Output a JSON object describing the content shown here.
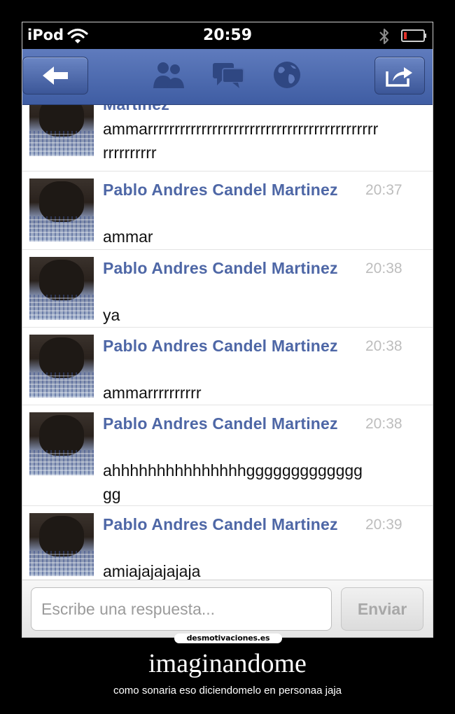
{
  "status_bar": {
    "carrier": "iPod",
    "time": "20:59",
    "wifi_icon": "wifi-icon",
    "bluetooth_icon": "bluetooth-icon",
    "battery_icon": "battery-low-icon",
    "battery_color": "#e0332b"
  },
  "nav_bar": {
    "back_icon": "back-arrow-icon",
    "tab_icons": [
      "friends-icon",
      "messages-icon",
      "globe-icon"
    ],
    "share_icon": "share-icon",
    "color": "#4b67ab"
  },
  "messages": [
    {
      "sender": "Martinez",
      "time": "",
      "text": "ammarrrrrrrrrrrrrrrrrrrrrrrrrrrrrrrrrrrrrrrrrrrrrrrrrrrrr"
    },
    {
      "sender": "Pablo Andres Candel Martinez",
      "time": "20:37",
      "text": "ammar"
    },
    {
      "sender": "Pablo Andres Candel Martinez",
      "time": "20:38",
      "text": "ya"
    },
    {
      "sender": "Pablo Andres Candel Martinez",
      "time": "20:38",
      "text": "ammarrrrrrrrrr"
    },
    {
      "sender": "Pablo Andres Candel Martinez",
      "time": "20:38",
      "text": "ahhhhhhhhhhhhhhhggggggggggggggg"
    },
    {
      "sender": "Pablo Andres Candel Martinez",
      "time": "20:39",
      "text": "amiajajajajaja"
    }
  ],
  "composer": {
    "placeholder": "Escribe una respuesta...",
    "send_label": "Enviar"
  },
  "poster": {
    "site": "desmotivaciones.es",
    "title": "imaginandome",
    "caption": "como sonaria eso diciendomelo en personaa jaja"
  }
}
